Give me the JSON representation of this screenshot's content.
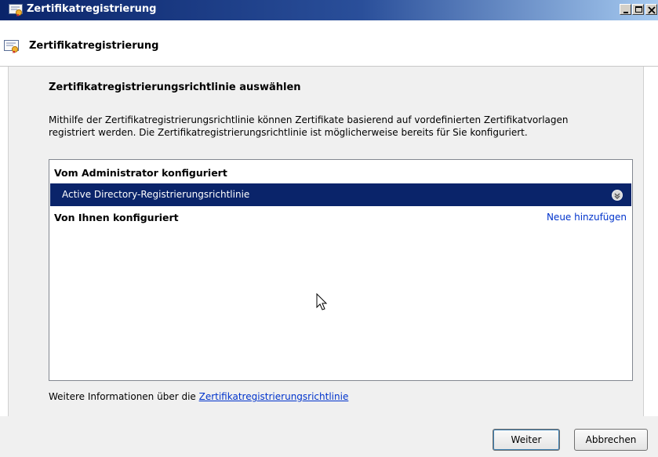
{
  "window": {
    "title": "Zertifikatregistrierung",
    "buttons": [
      "minimize",
      "maximize",
      "close"
    ]
  },
  "header": {
    "title": "Zertifikatregistrierung",
    "icon": "certificate-icon"
  },
  "content": {
    "section_title": "Zertifikatregistrierungsrichtlinie auswählen",
    "description": "Mithilfe der Zertifikatregistrierungsrichtlinie können Zertifikate basierend auf vordefinierten Zertifikatvorlagen registriert werden. Die Zertifikatregistrierungsrichtlinie ist möglicherweise bereits für Sie konfiguriert.",
    "list": {
      "admin_group": "Vom Administrator konfiguriert",
      "selected_policy": "Active Directory-Registrierungsrichtlinie",
      "user_group": "Von Ihnen konfiguriert",
      "add_link": "Neue hinzufügen"
    },
    "more_info": {
      "prefix": "Weitere Informationen über die ",
      "link": "Zertifikatregistrierungsrichtlinie"
    }
  },
  "footer": {
    "next_label": "Weiter",
    "cancel_label": "Abbrechen"
  },
  "colors": {
    "title_bar": "#0a246a",
    "selection": "#0a246a",
    "link": "#0033cc",
    "panel": "#f0f0f0"
  }
}
